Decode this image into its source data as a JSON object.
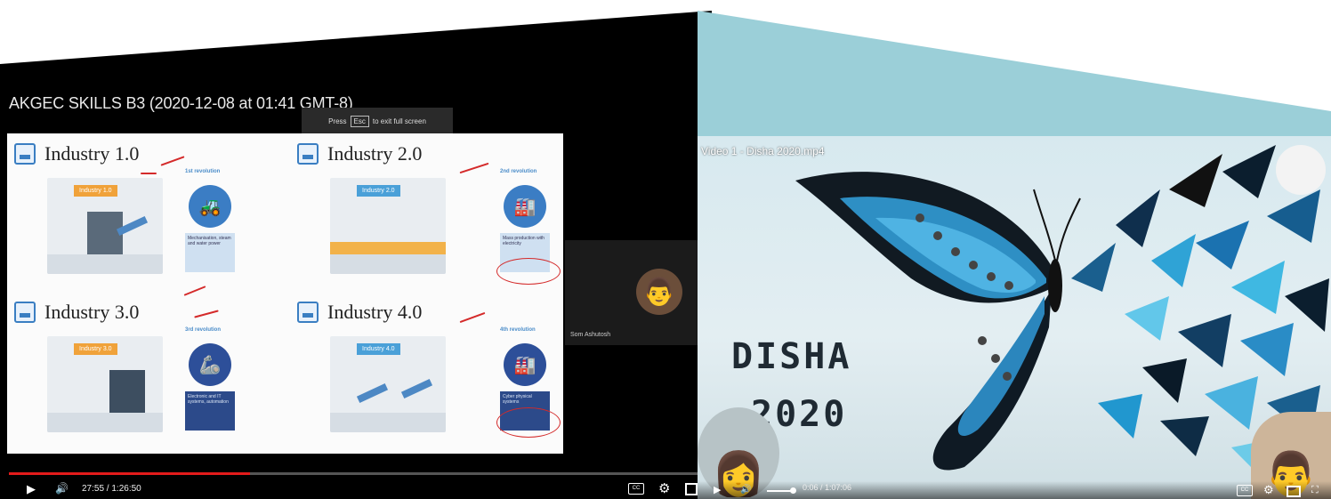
{
  "left_player": {
    "title": "AKGEC SKILLS B3 (2020-12-08 at 01:41 GMT-8)",
    "fullscreen_hint": {
      "prefix": "Press",
      "key": "Esc",
      "suffix": "to exit full screen"
    },
    "slide": {
      "sections": [
        {
          "title": "Industry 1.0",
          "revolution": "1st revolution",
          "tag": "Industry 1.0",
          "note": "Mechanisation, steam and water power",
          "icon": "tractor-icon"
        },
        {
          "title": "Industry 2.0",
          "revolution": "2nd revolution",
          "tag": "Industry 2.0",
          "note": "Mass production with electricity",
          "icon": "factory-icon"
        },
        {
          "title": "Industry 3.0",
          "revolution": "3rd revolution",
          "tag": "Industry 3.0",
          "note": "Electronic and IT systems, automation",
          "icon": "robot-arm-icon"
        },
        {
          "title": "Industry 4.0",
          "revolution": "4th revolution",
          "tag": "Industry 4.0",
          "note": "Cyber physical systems",
          "icon": "smart-factory-icon"
        }
      ]
    },
    "participant": {
      "name": "Som Ashutosh"
    },
    "progress": 0.35,
    "time": "27:55 / 1:26:50",
    "controls": {
      "play": "▶",
      "volume": "🔊",
      "cc": "CC",
      "settings": "⚙"
    }
  },
  "right_player": {
    "title": "Video 1 - Disha 2020.mp4",
    "art_text": {
      "word": "DISHA",
      "year": "2020"
    },
    "time": "0:06 / 1:07:06",
    "volume": 0.8,
    "controls": {
      "play": "▶",
      "volume": "🔊",
      "cc": "CC",
      "settings": "⚙"
    }
  }
}
